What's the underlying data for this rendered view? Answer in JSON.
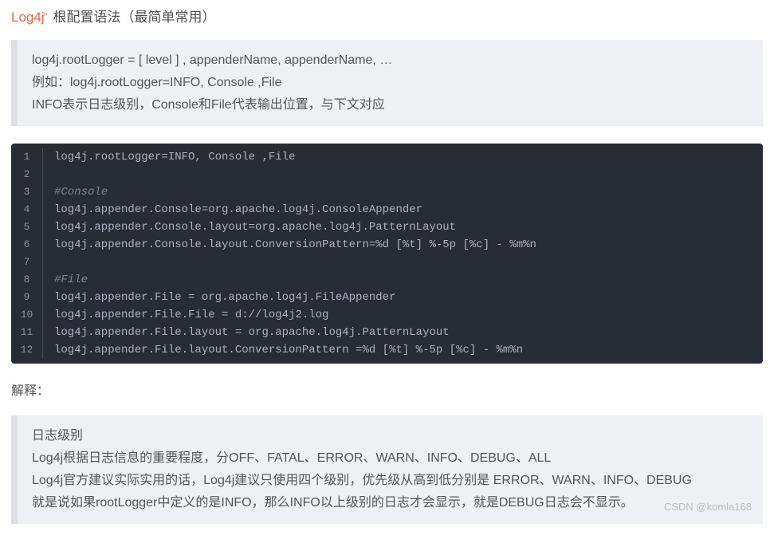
{
  "heading": {
    "prefix": "Log4j",
    "searchGlyph": "⌕",
    "suffix": " 根配置语法（最简单常用）"
  },
  "intro": {
    "line1": "log4j.rootLogger = [ level ] , appenderName, appenderName, …",
    "line2": "例如：log4j.rootLogger=INFO, Console ,File",
    "line3": "INFO表示日志级别，Console和File代表输出位置，与下文对应"
  },
  "code": {
    "lines": [
      {
        "n": "1",
        "text": "log4j.rootLogger=INFO, Console ,File",
        "comment": false
      },
      {
        "n": "2",
        "text": "",
        "comment": false
      },
      {
        "n": "3",
        "text": "#Console",
        "comment": true
      },
      {
        "n": "4",
        "text": "log4j.appender.Console=org.apache.log4j.ConsoleAppender",
        "comment": false
      },
      {
        "n": "5",
        "text": "log4j.appender.Console.layout=org.apache.log4j.PatternLayout",
        "comment": false
      },
      {
        "n": "6",
        "text": "log4j.appender.Console.layout.ConversionPattern=%d [%t] %-5p [%c] - %m%n",
        "comment": false
      },
      {
        "n": "7",
        "text": "",
        "comment": false
      },
      {
        "n": "8",
        "text": "#File",
        "comment": true
      },
      {
        "n": "9",
        "text": "log4j.appender.File = org.apache.log4j.FileAppender",
        "comment": false
      },
      {
        "n": "10",
        "text": "log4j.appender.File.File = d://log4j2.log",
        "comment": false
      },
      {
        "n": "11",
        "text": "log4j.appender.File.layout = org.apache.log4j.PatternLayout",
        "comment": false
      },
      {
        "n": "12",
        "text": "log4j.appender.File.layout.ConversionPattern =%d [%t] %-5p [%c] - %m%n",
        "comment": false
      }
    ]
  },
  "explainLabel": "解释：",
  "explanation": {
    "line1": "日志级别",
    "line2": "Log4j根据日志信息的重要程度，分OFF、FATAL、ERROR、WARN、INFO、DEBUG、ALL",
    "line3": "Log4j官方建议实际实用的话，Log4j建议只使用四个级别，优先级从高到低分别是 ERROR、WARN、INFO、DEBUG",
    "line4": "就是说如果rootLogger中定义的是INFO，那么INFO以上级别的日志才会显示，就是DEBUG日志会不显示。"
  },
  "watermark": "CSDN @komla168"
}
